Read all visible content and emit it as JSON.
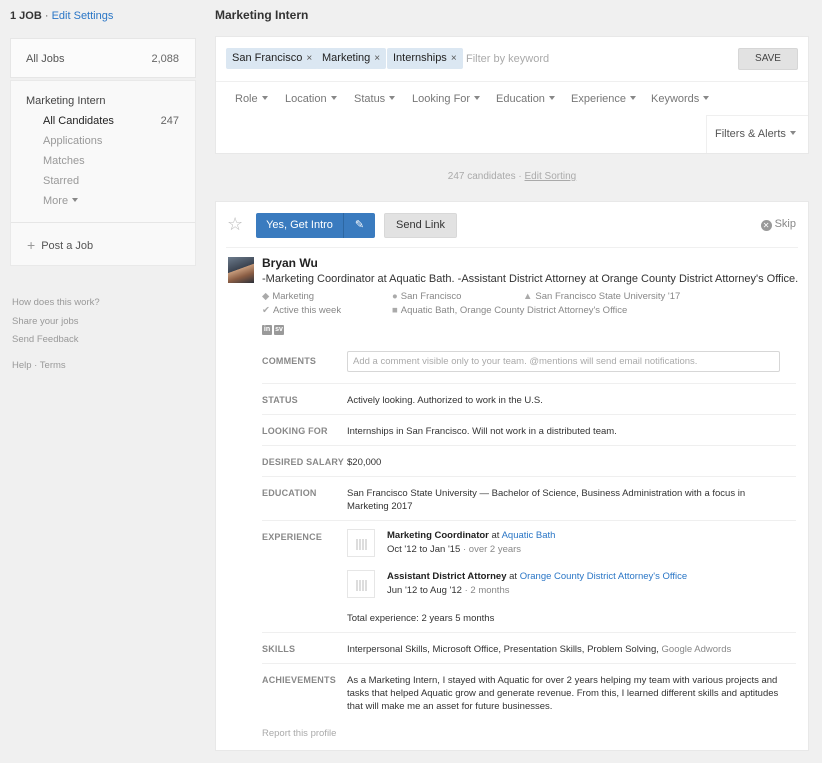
{
  "sidebar": {
    "job_count": "1 JOB",
    "separator": "·",
    "edit_settings": "Edit Settings",
    "all_jobs_label": "All Jobs",
    "all_jobs_count": "2,088",
    "job_title": "Marketing Intern",
    "items": [
      {
        "label": "All Candidates",
        "count": "247"
      },
      {
        "label": "Applications"
      },
      {
        "label": "Matches"
      },
      {
        "label": "Starred"
      },
      {
        "label": "More"
      }
    ],
    "post_job": "Post a Job",
    "links": {
      "how": "How does this work?",
      "share": "Share your jobs",
      "feedback": "Send Feedback",
      "help": "Help · Terms"
    }
  },
  "header": {
    "title": "Marketing Intern"
  },
  "filters": {
    "chips": [
      "San Francisco",
      "Marketing",
      "Internships"
    ],
    "chip_remove": "×",
    "keyword_placeholder": "Filter by keyword",
    "save_label": "SAVE",
    "dropdowns": [
      "Role",
      "Location",
      "Status",
      "Looking For",
      "Education",
      "Experience",
      "Keywords"
    ],
    "alerts_label": "Filters & Alerts"
  },
  "results": {
    "count_text": "247 candidates ·",
    "edit_sorting": "Edit Sorting"
  },
  "candidate": {
    "intro_label": "Yes, Get Intro",
    "send_link": "Send Link",
    "skip": "Skip",
    "name": "Bryan Wu",
    "headline": "-Marketing Coordinator at Aquatic Bath. -Assistant District Attorney at Orange County District Attorney's Office.",
    "role": "Marketing",
    "location": "San Francisco",
    "school": "San Francisco State University '17",
    "activity": "Active this week",
    "companies": "Aquatic Bath, Orange County District Attorney's Office",
    "social": [
      "in",
      "sv"
    ],
    "rows": {
      "comments_label": "COMMENTS",
      "comments_placeholder": "Add a comment visible only to your team. @mentions will send email notifications.",
      "status_label": "STATUS",
      "status_value": "Actively looking. Authorized to work in the U.S.",
      "looking_label": "LOOKING FOR",
      "looking_value": "Internships in San Francisco. Will not work in a distributed team.",
      "salary_label": "DESIRED SALARY",
      "salary_value": "$20,000",
      "education_label": "EDUCATION",
      "education_value": "San Francisco State University — Bachelor of Science, Business Administration with a focus in Marketing 2017",
      "experience_label": "EXPERIENCE",
      "experience": [
        {
          "title": "Marketing Coordinator",
          "at": "at",
          "company": "Aquatic Bath",
          "dates": "Oct '12 to Jan '15",
          "duration": "· over 2 years"
        },
        {
          "title": "Assistant District Attorney",
          "at": "at",
          "company": "Orange County District Attorney's Office",
          "dates": "Jun '12 to Aug '12",
          "duration": "· 2 months"
        }
      ],
      "total_experience": "Total experience: 2 years 5 months",
      "skills_label": "SKILLS",
      "skills": [
        "Interpersonal Skills,",
        "Microsoft Office,",
        "Presentation Skills,",
        "Problem Solving,",
        "Google Adwords"
      ],
      "achievements_label": "ACHIEVEMENTS",
      "achievements_value": "As a Marketing Intern, I stayed with Aquatic for over 2 years helping my team with various projects and tasks that helped Aquatic grow and generate revenue. From this, I learned different skills and aptitudes that will make me an asset for future businesses."
    },
    "report": "Report this profile"
  }
}
